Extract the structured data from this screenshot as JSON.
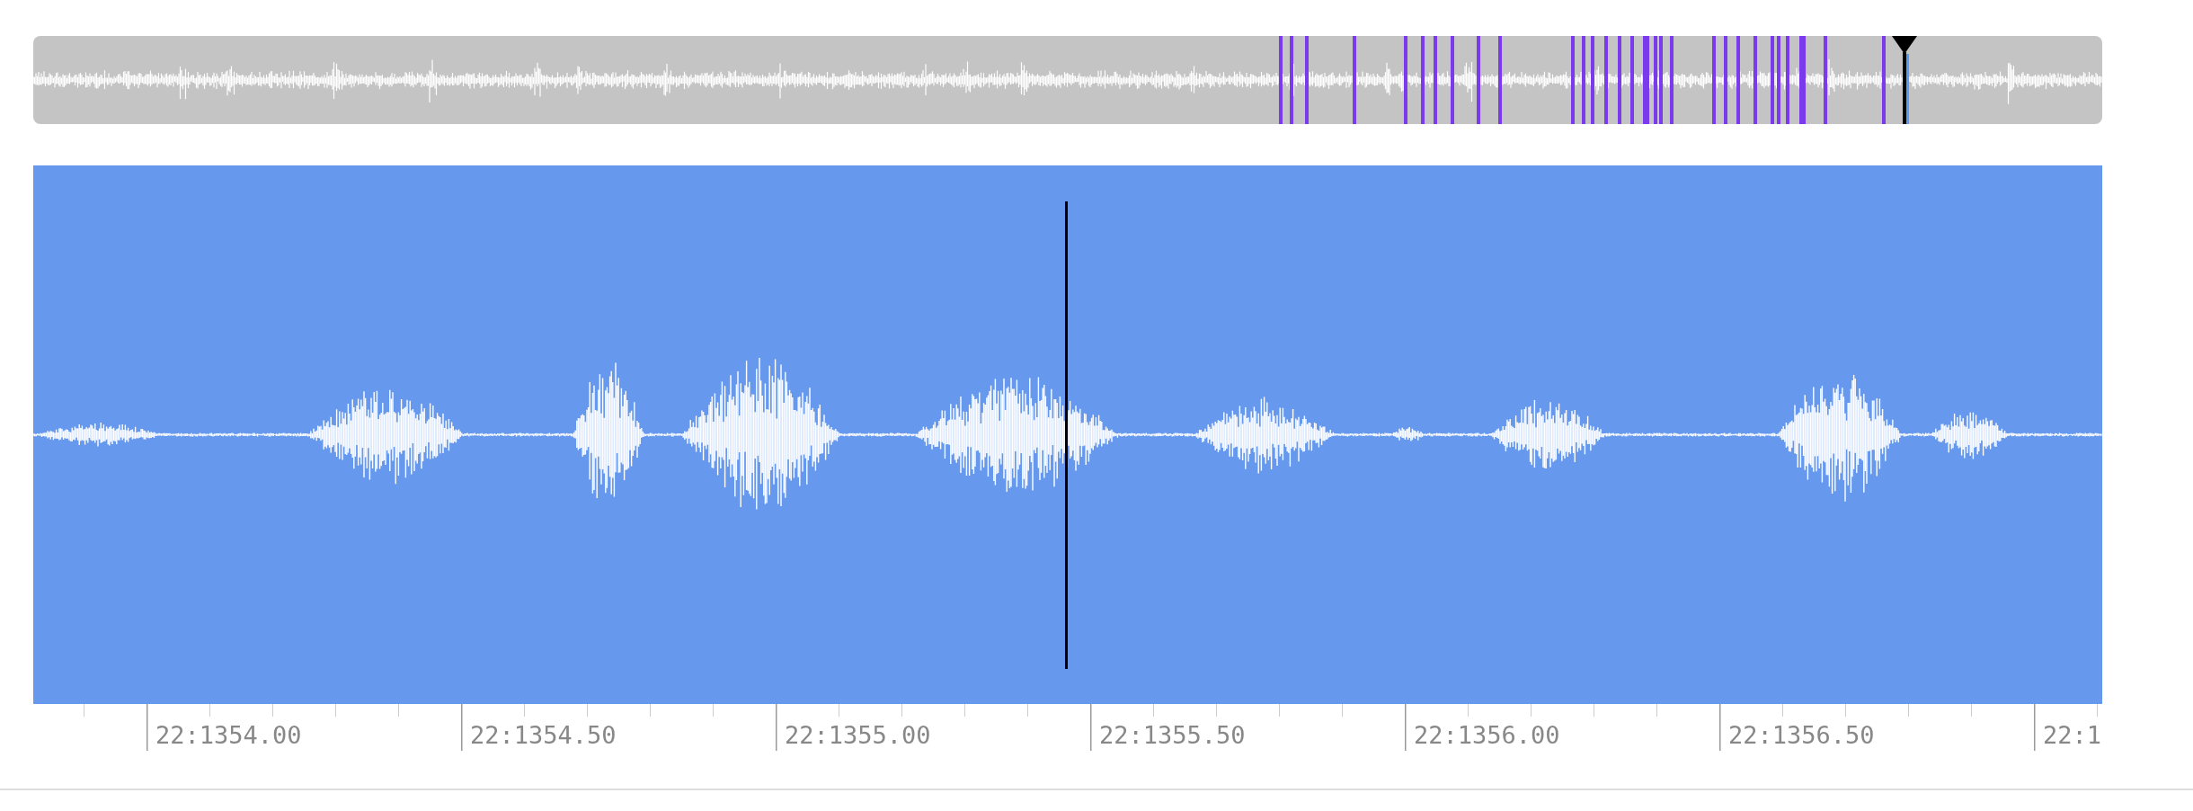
{
  "time_axis": {
    "labels": [
      "22:1354.00",
      "22:1354.50",
      "22:1355.00",
      "22:1355.50",
      "22:1356.00",
      "22:1356.50",
      "22:1"
    ]
  }
}
